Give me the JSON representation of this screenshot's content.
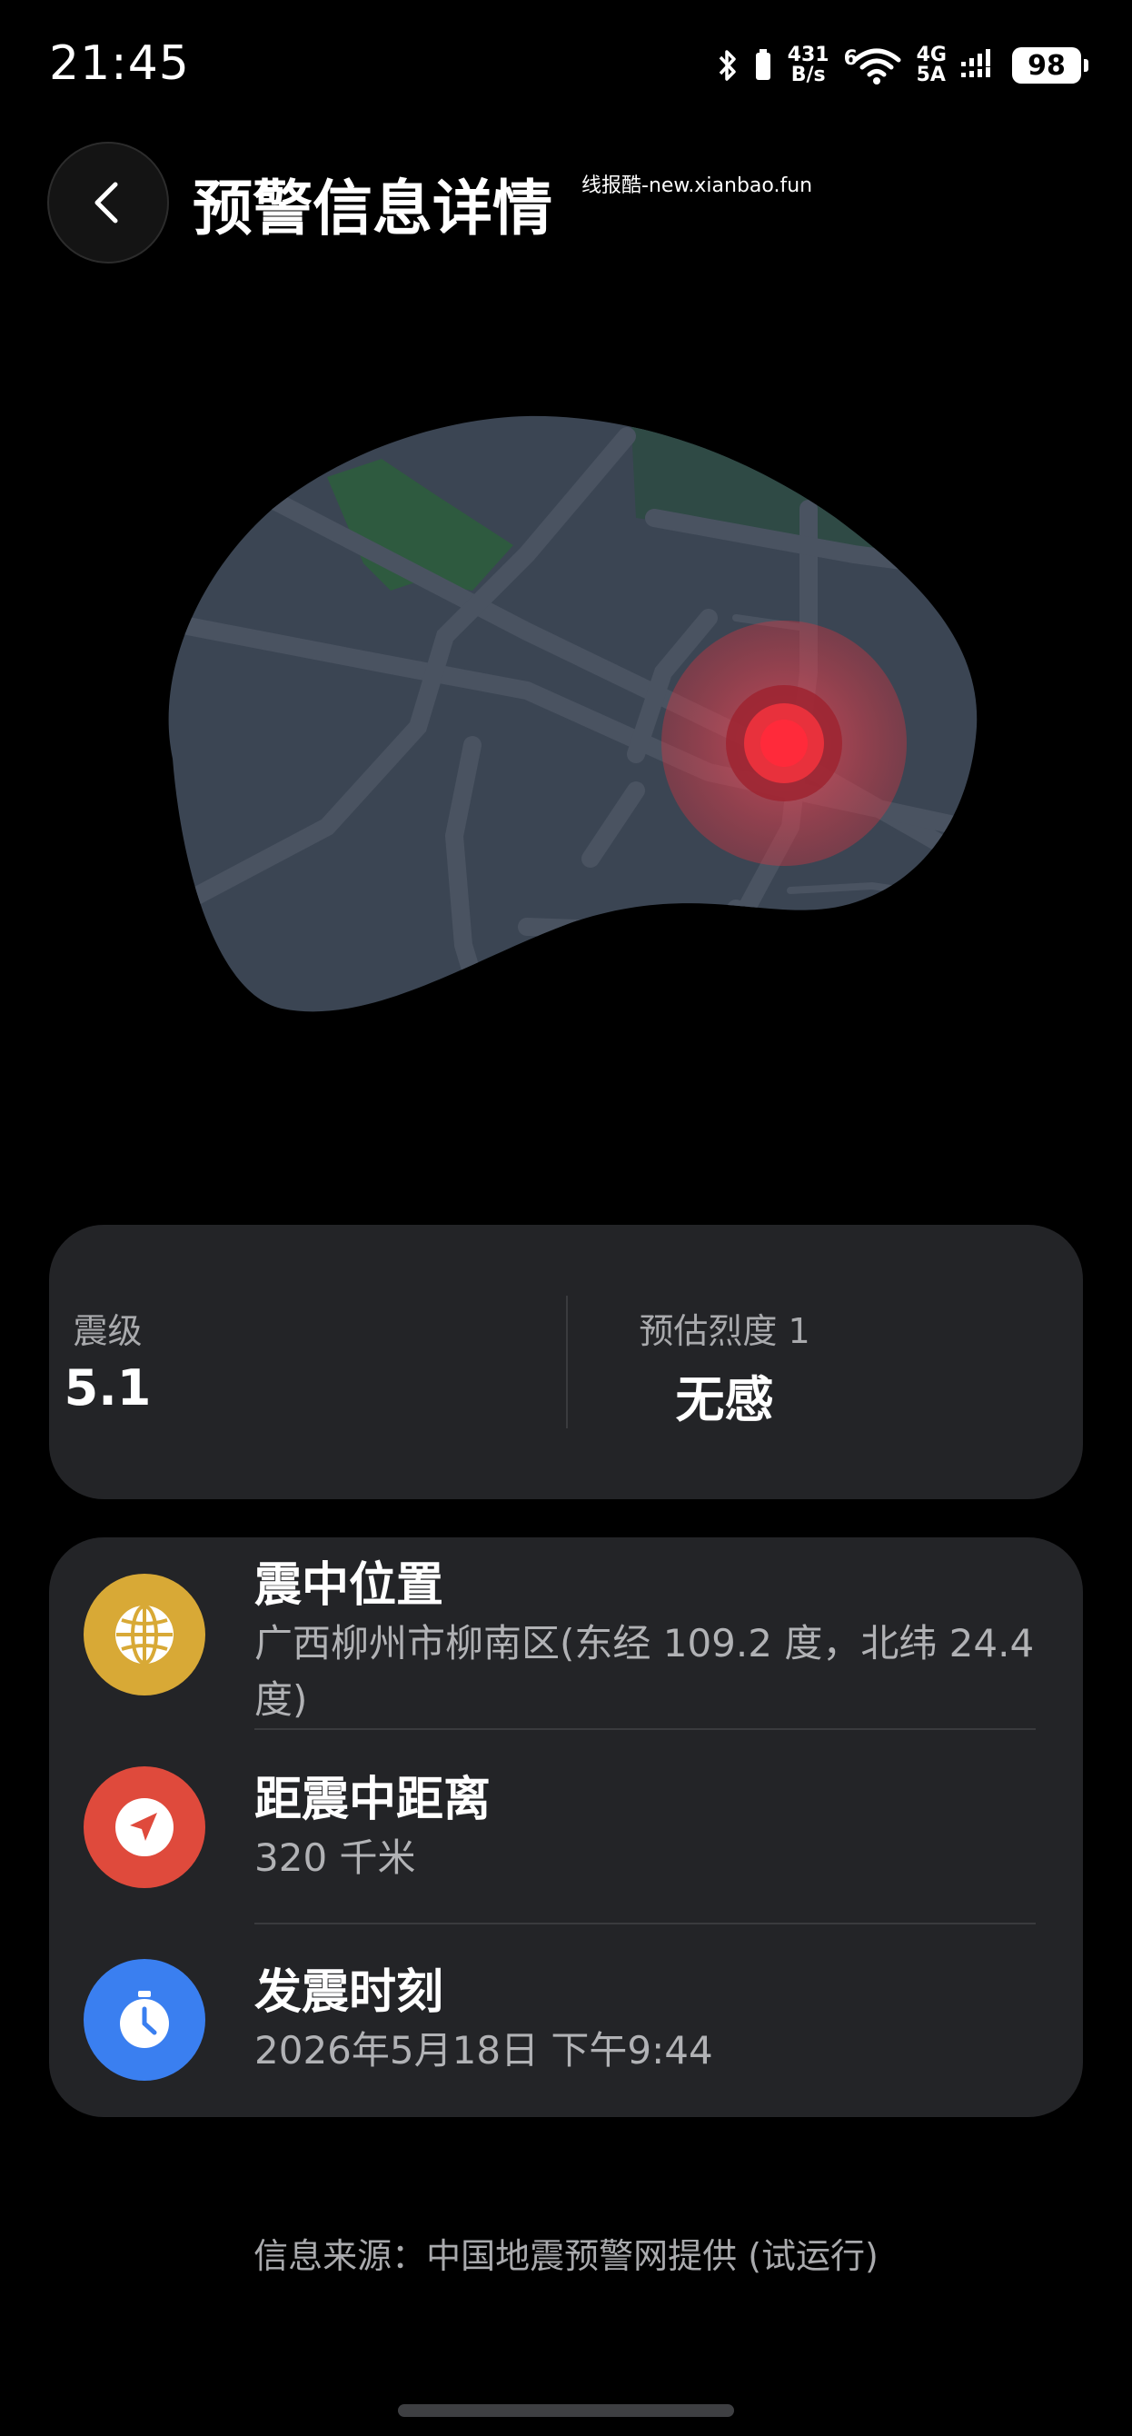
{
  "status_bar": {
    "time": "21:45",
    "net_speed_value": "431",
    "net_speed_unit": "B/s",
    "wifi_label": "6",
    "signal_top": "4G",
    "signal_bottom": "5A",
    "battery": "98",
    "icons": [
      "bluetooth-icon",
      "vibrate-icon",
      "wifi-icon",
      "cellular-signal-icon",
      "battery-icon"
    ]
  },
  "header": {
    "title": "预警信息详情",
    "watermark": "线报酷-new.xianbao.fun"
  },
  "map": {
    "accent": "#e8313c",
    "land_color": "#3b4553",
    "park_color": "#2e5a3f"
  },
  "magnitude_card": {
    "magnitude_label": "震级",
    "magnitude_value": "5.1",
    "intensity_label": "预估烈度 1",
    "intensity_value": "无感"
  },
  "info_card": {
    "rows": [
      {
        "title": "震中位置",
        "subtitle": "广西柳州市柳南区(东经 109.2 度，北纬 24.4 度)",
        "icon": "globe-icon",
        "color": "#d8a936"
      },
      {
        "title": "距震中距离",
        "subtitle": "320 千米",
        "icon": "navigation-arrow-icon",
        "color": "#df4a3c"
      },
      {
        "title": "发震时刻",
        "subtitle": "2026年5月18日 下午9:44",
        "icon": "stopwatch-icon",
        "color": "#3a7ff0"
      }
    ]
  },
  "footer": {
    "source": "信息来源：中国地震预警网提供 (试运行)"
  }
}
